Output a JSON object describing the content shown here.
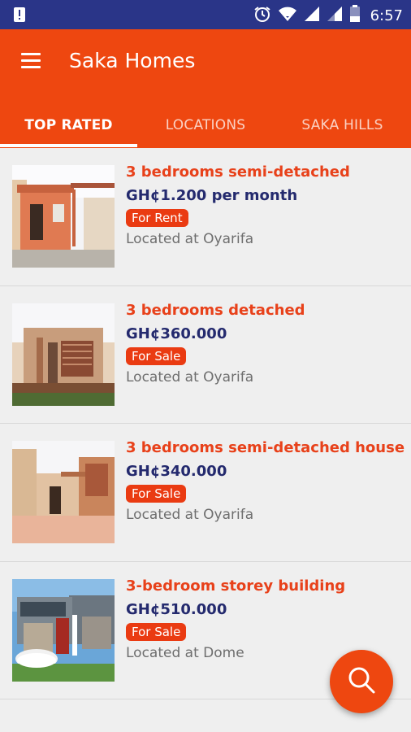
{
  "status_bar": {
    "time": "6:57",
    "icons": [
      "notification-icon",
      "alarm-icon",
      "wifi-icon",
      "signal-icon",
      "signal-2-icon",
      "battery-icon"
    ]
  },
  "app_bar": {
    "title": "Saka Homes",
    "menu_icon": "menu-icon"
  },
  "tabs": [
    {
      "label": "TOP RATED",
      "active": true
    },
    {
      "label": "LOCATIONS",
      "active": false
    },
    {
      "label": "SAKA HILLS",
      "active": false
    }
  ],
  "listings": [
    {
      "title": "3 bedrooms semi-detached",
      "price": "GH¢1.200 per month",
      "badge": "For Rent",
      "location": "Located at Oyarifa"
    },
    {
      "title": "3 bedrooms detached",
      "price": "GH¢360.000",
      "badge": "For Sale",
      "location": "Located at Oyarifa"
    },
    {
      "title": "3 bedrooms semi-detached house",
      "price": "GH¢340.000",
      "badge": "For Sale",
      "location": "Located at Oyarifa"
    },
    {
      "title": "3-bedroom storey building",
      "price": "GH¢510.000",
      "badge": "For Sale",
      "location": "Located at Dome"
    }
  ],
  "fab": {
    "icon": "search-icon"
  },
  "colors": {
    "status_bar": "#2a3588",
    "accent": "#ee4710",
    "price": "#242a6e",
    "title": "#e8411a",
    "background": "#efefef"
  }
}
